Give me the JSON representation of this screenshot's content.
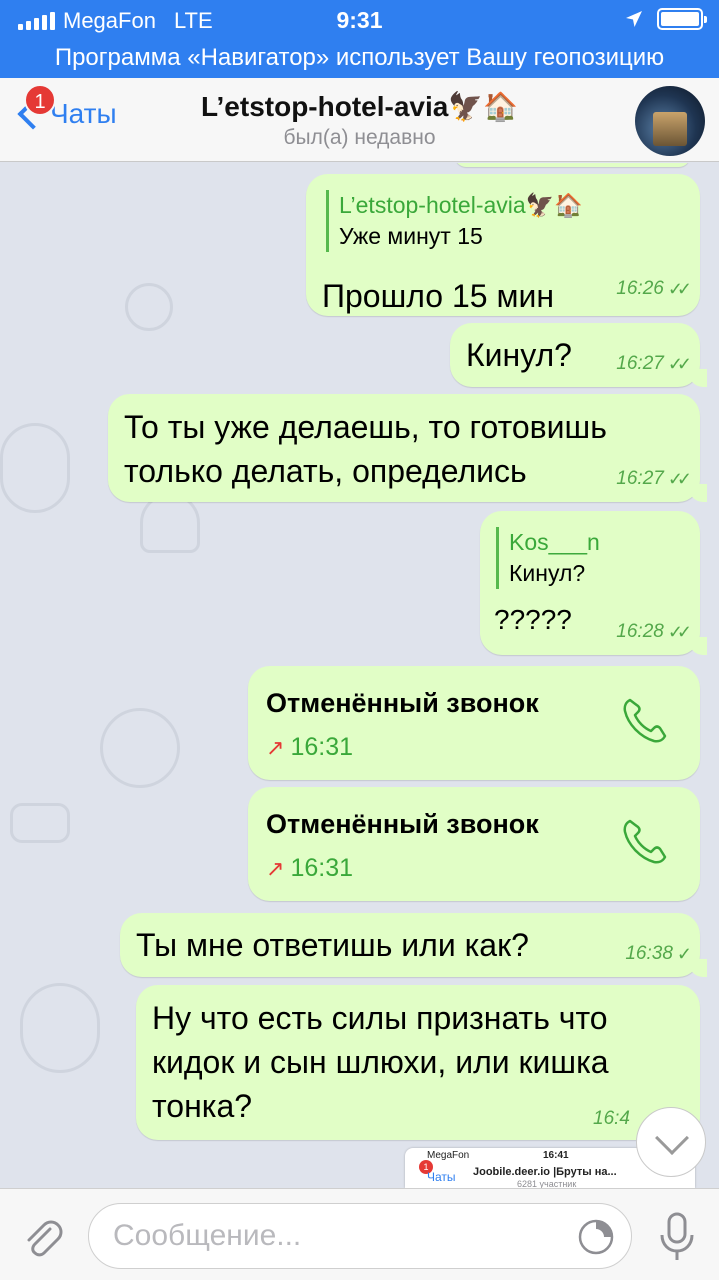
{
  "status_bar": {
    "carrier": "MegaFon",
    "network": "LTE",
    "time": "9:31"
  },
  "geo_banner": "Программа «Навигатор» использует Вашу геопозицию",
  "nav": {
    "back_label": "Чаты",
    "back_badge": "1",
    "title": "L’etstop-hotel-avia🦅🏠",
    "subtitle": "был(а) недавно"
  },
  "messages": [
    {
      "reply_name": "L’etstop-hotel-avia🦅🏠",
      "reply_text": "Уже минут 15",
      "text": "Прошло 15 мин",
      "time": "16:26",
      "ticks": "✓✓"
    },
    {
      "text": "Кинул?",
      "time": "16:27",
      "ticks": "✓✓"
    },
    {
      "text_line1": "То ты уже делаешь, то готовишь",
      "text_line2": "только делать, определись",
      "time": "16:27",
      "ticks": "✓✓"
    },
    {
      "reply_name": "Kos___n",
      "reply_text": "Кинул?",
      "text": "?????",
      "time": "16:28",
      "ticks": "✓✓"
    },
    {
      "call_title": "Отменённый звонок",
      "call_arrow": "↗",
      "time": "16:31"
    },
    {
      "call_title": "Отменённый звонок",
      "call_arrow": "↗",
      "time": "16:31"
    },
    {
      "text": "Ты мне ответишь или как?",
      "time": "16:38",
      "ticks": "✓"
    },
    {
      "text_line1": "Ну что есть силы признать что",
      "text_line2": "кидок и сын шлюхи, или кишка",
      "text_line3": "тонка?",
      "time": "16:4"
    }
  ],
  "preview": {
    "carrier": "MegaFon",
    "time": "16:41",
    "back_label": "Чаты",
    "back_badge": "1",
    "title": "Joobile.deer.io |Бруты на...",
    "subtitle": "6281 участник"
  },
  "input": {
    "placeholder": "Сообщение..."
  },
  "colors": {
    "accent": "#2f7ff0",
    "bubble_out": "#e1fec6",
    "time_green": "#54a84b",
    "missed_red": "#e53935"
  }
}
